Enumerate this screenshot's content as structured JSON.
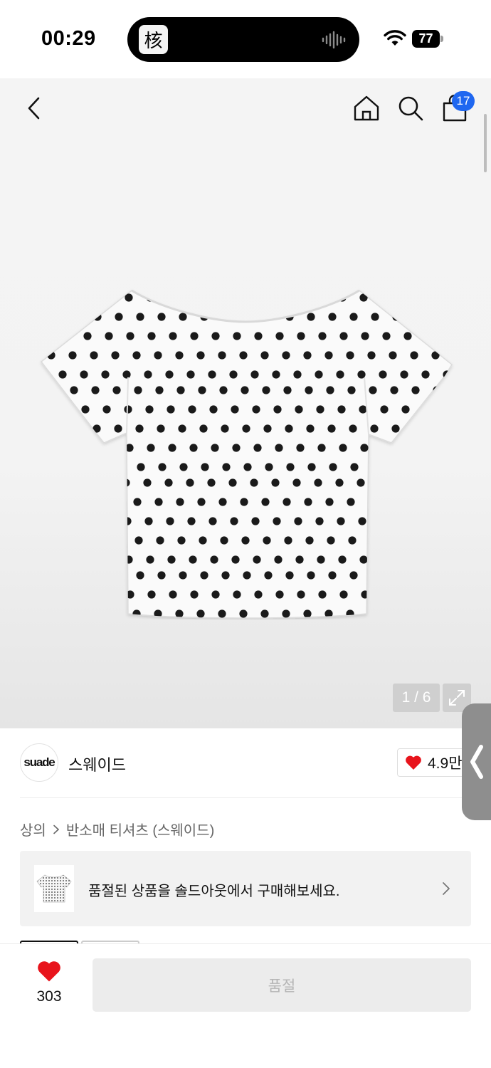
{
  "status_bar": {
    "time": "00:29",
    "app_glyph": "核",
    "battery": "77"
  },
  "nav": {
    "cart_count": "17"
  },
  "gallery": {
    "pager": "1 / 6"
  },
  "brand": {
    "logo_text": "suade",
    "name": "스웨이드",
    "likes": "4.9만"
  },
  "breadcrumb": {
    "category": "상의",
    "subcategory": "반소매 티셔츠 (스웨이드)"
  },
  "soldout_banner": {
    "text": "품절된 상품을 솔드아웃에서 구매해보세요."
  },
  "bottom_bar": {
    "wish_count": "303",
    "buy_label": "품절"
  },
  "colors": {
    "accent_blue": "#1f67f0",
    "heart_red": "#e8141c"
  }
}
